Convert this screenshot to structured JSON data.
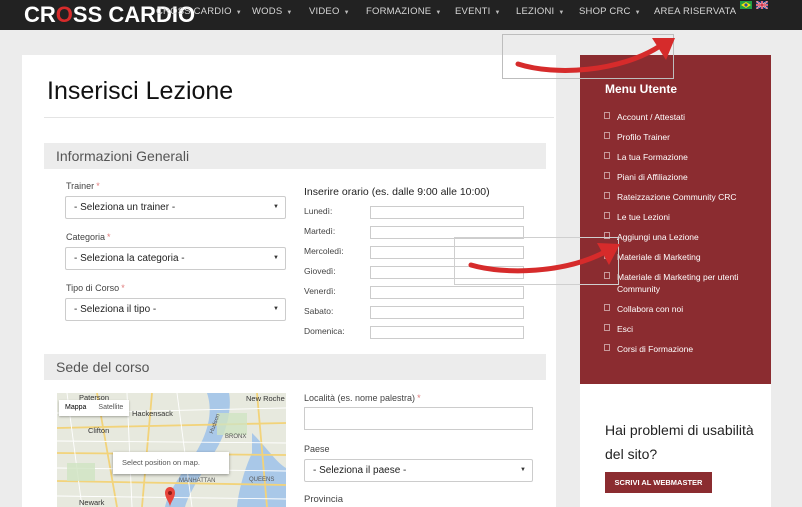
{
  "nav": {
    "logo": {
      "c": "C",
      "ross": "R",
      "o": "O",
      "rest": "SS CARDIO"
    },
    "items": [
      {
        "label": "CROSS CARDIO"
      },
      {
        "label": "WODS"
      },
      {
        "label": "VIDEO"
      },
      {
        "label": "FORMAZIONE"
      },
      {
        "label": "EVENTI"
      },
      {
        "label": "LEZIONI"
      },
      {
        "label": "SHOP CRC"
      },
      {
        "label": "AREA RISERVATA"
      }
    ],
    "caret": "▼"
  },
  "page_title": "Inserisci Lezione",
  "general": {
    "heading": "Informazioni Generali",
    "trainer": {
      "label": "Trainer",
      "required": "*",
      "value": "- Seleziona un trainer -"
    },
    "categoria": {
      "label": "Categoria",
      "required": "*",
      "value": "- Seleziona la categoria -"
    },
    "tipo": {
      "label": "Tipo di Corso",
      "required": "*",
      "value": "- Seleziona il tipo -"
    },
    "orario": {
      "label": "Inserire orario (es. dalle 9:00 alle 10:00)",
      "days": [
        "Lunedì:",
        "Martedì:",
        "Mercoledì:",
        "Giovedì:",
        "Venerdì:",
        "Sabato:",
        "Domenica:"
      ]
    }
  },
  "sede": {
    "heading": "Sede del corso",
    "localita": {
      "label": "Località (es. nome palestra)",
      "required": "*"
    },
    "paese": {
      "label": "Paese",
      "value": "- Seleziona il paese -"
    },
    "provincia": {
      "label": "Provincia"
    },
    "map": {
      "tab_map": "Mappa",
      "tab_sat": "Satellite",
      "tooltip": "Select position on map.",
      "places": {
        "paterson": "Paterson",
        "hackensack": "Hackensack",
        "new_roche": "New Roche",
        "clifton": "Clifton",
        "bronx": "BRONX",
        "newark": "Newark",
        "hudson": "Hudson",
        "manhattan": "MANHATTAN",
        "queens": "QUEENS"
      }
    }
  },
  "sidebar": {
    "title": "Menu Utente",
    "items": [
      "Account / Attestati",
      "Profilo Trainer",
      "La tua Formazione",
      "Piani di Affiliazione",
      "Rateizzazione Community CRC",
      "Le tue Lezioni",
      "Aggiungi una Lezione",
      "Materiale di Marketing",
      "Materiale di Marketing per utenti Community",
      "Collabora con noi",
      "Esci",
      "Corsi di Formazione"
    ]
  },
  "help": {
    "text": "Hai problemi di usabilità del sito?",
    "button": "SCRIVI AL WEBMASTER"
  },
  "colors": {
    "sidebar_bg": "#8b2c30",
    "nav_bg": "#222222",
    "arrow_red": "#d62b2b"
  }
}
